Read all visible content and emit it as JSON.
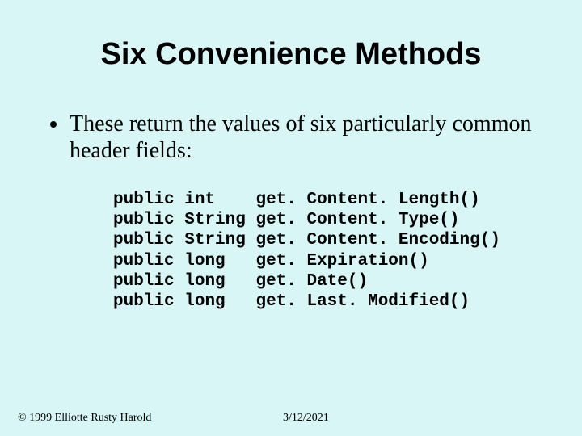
{
  "title": "Six Convenience Methods",
  "bullet": "These return the values of six particularly common header fields:",
  "code": [
    {
      "mod": "public",
      "type": "int",
      "name": "get. Content. Length()"
    },
    {
      "mod": "public",
      "type": "String",
      "name": "get. Content. Type()"
    },
    {
      "mod": "public",
      "type": "String",
      "name": "get. Content. Encoding()"
    },
    {
      "mod": "public",
      "type": "long",
      "name": "get. Expiration()"
    },
    {
      "mod": "public",
      "type": "long",
      "name": "get. Date()"
    },
    {
      "mod": "public",
      "type": "long",
      "name": "get. Last. Modified()"
    }
  ],
  "footer": {
    "copyright": "© 1999 Elliotte Rusty Harold",
    "date": "3/12/2021"
  }
}
